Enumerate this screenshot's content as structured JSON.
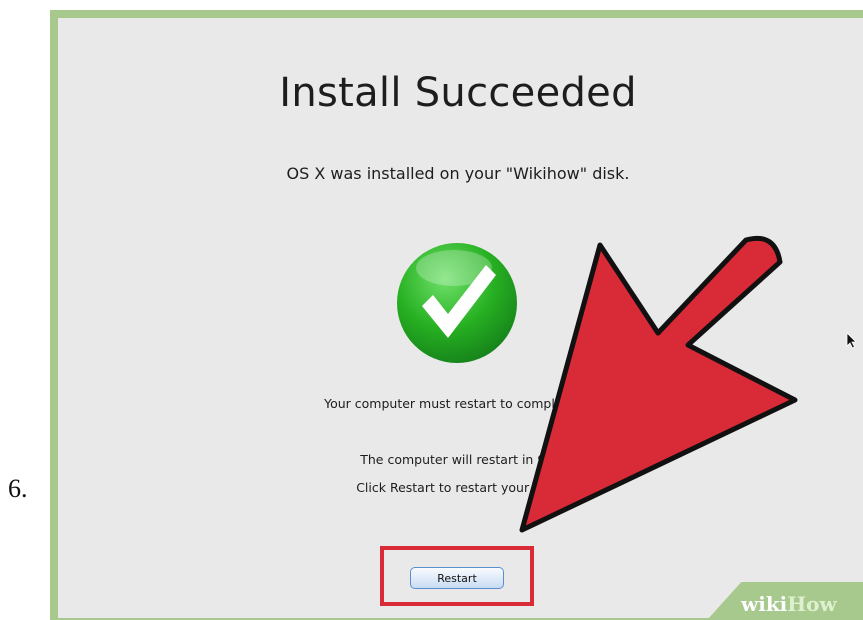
{
  "step_number": "6.",
  "dialog": {
    "title": "Install Succeeded",
    "subtitle": "OS X was installed on your \"Wikihow\" disk.",
    "status_icon": "checkmark-icon",
    "message_1": "Your computer must restart to complete th",
    "message_2": "The computer will restart in 9 s",
    "message_3": "Click Restart to restart your com",
    "restart_label": "Restart"
  },
  "annotation": {
    "arrow_color": "#d92a37",
    "highlight_color": "#d92a37"
  },
  "watermark": {
    "part1": "wiki",
    "part2": "How"
  },
  "colors": {
    "frame": "#a8c98e",
    "screen_bg": "#e9e9e9",
    "check_green": "#2fb52b"
  }
}
